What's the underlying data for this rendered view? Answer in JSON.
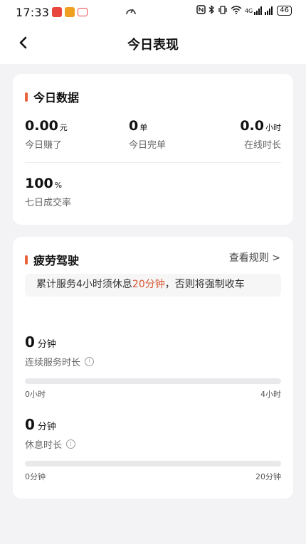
{
  "status_bar": {
    "time": "17:33",
    "battery": "46",
    "network": "4G"
  },
  "header": {
    "title": "今日表现"
  },
  "today_data": {
    "title": "今日数据",
    "earned": {
      "value": "0.00",
      "unit": "元",
      "label": "今日赚了"
    },
    "orders": {
      "value": "0",
      "unit": "单",
      "label": "今日完单"
    },
    "online": {
      "value": "0.0",
      "unit": "小时",
      "label": "在线时长"
    },
    "rate": {
      "value": "100",
      "unit": "%",
      "label": "七日成交率"
    }
  },
  "fatigue": {
    "title": "疲劳驾驶",
    "rules_link": "查看规则 >",
    "notice_prefix": "累计服务4小时须休息",
    "notice_highlight": "20分钟",
    "notice_suffix": "，否则将强制收车",
    "continuous": {
      "value": "0",
      "unit": "分钟",
      "label": "连续服务时长",
      "progress": 0,
      "min_label": "0小时",
      "max_label": "4小时"
    },
    "rest": {
      "value": "0",
      "unit": "分钟",
      "label": "休息时长",
      "progress": 0,
      "min_label": "0分钟",
      "max_label": "20分钟"
    }
  },
  "colors": {
    "accent": "#e9633b",
    "highlight": "#d9552f",
    "track": "#e9e9eb",
    "background": "#f3f3f5"
  },
  "icons": {
    "back": "chevron-left-icon",
    "info": "info-circle-icon"
  }
}
